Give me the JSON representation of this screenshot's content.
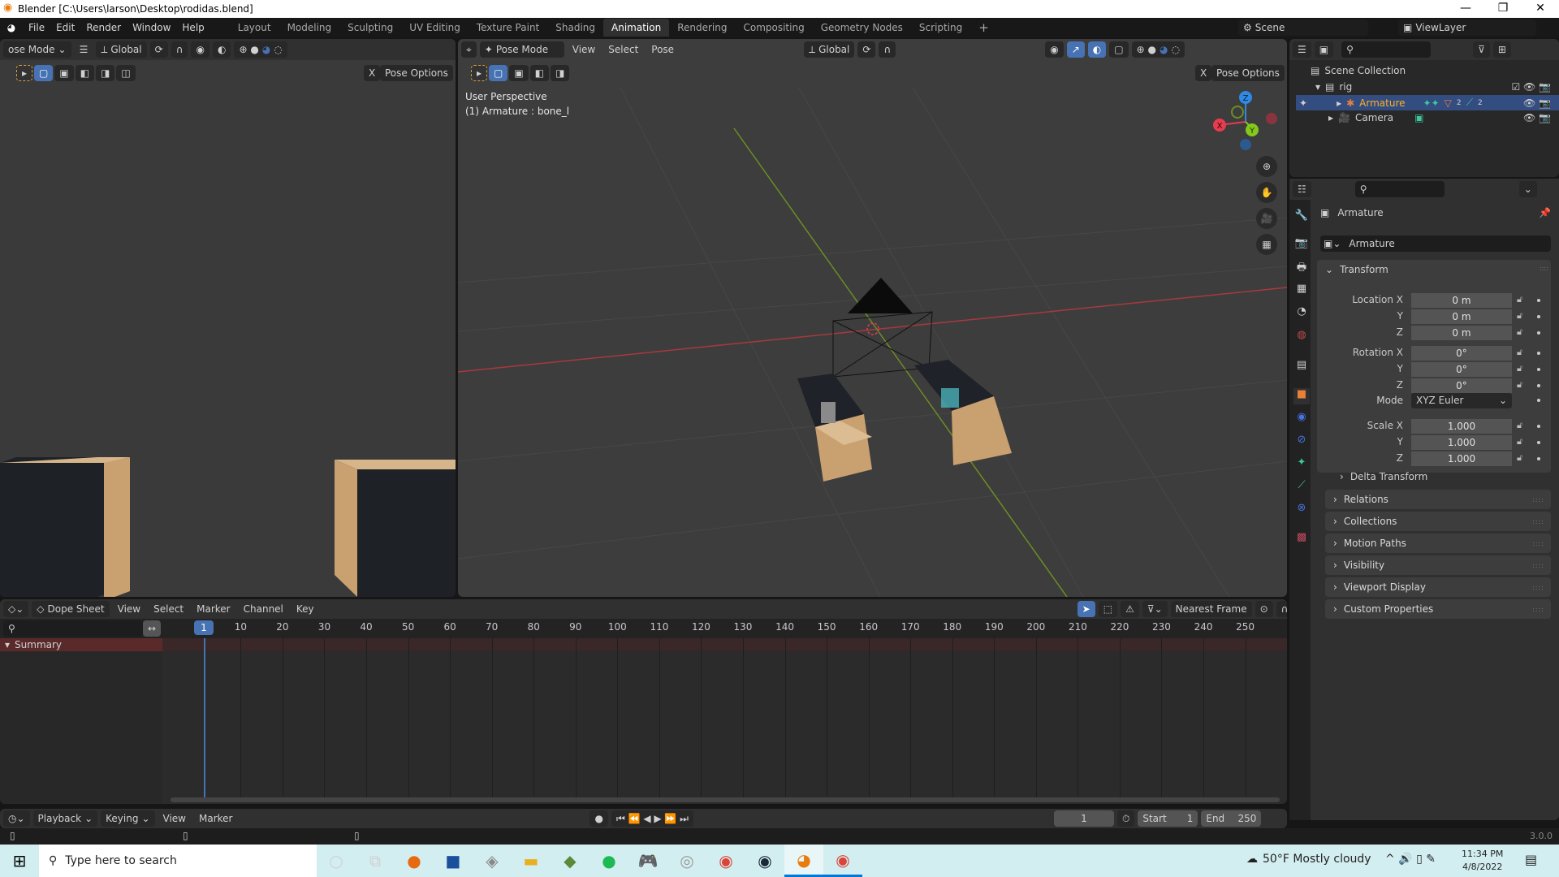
{
  "window": {
    "title": "Blender [C:\\Users\\larson\\Desktop\\rodidas.blend]",
    "minimize": "—",
    "maximize": "❐",
    "close": "✕"
  },
  "menu": [
    "File",
    "Edit",
    "Render",
    "Window",
    "Help"
  ],
  "workspaces": [
    {
      "label": "Layout"
    },
    {
      "label": "Modeling"
    },
    {
      "label": "Sculpting"
    },
    {
      "label": "UV Editing"
    },
    {
      "label": "Texture Paint"
    },
    {
      "label": "Shading"
    },
    {
      "label": "Animation",
      "active": true
    },
    {
      "label": "Rendering"
    },
    {
      "label": "Compositing"
    },
    {
      "label": "Geometry Nodes"
    },
    {
      "label": "Scripting"
    }
  ],
  "add_workspace": "+",
  "scene": {
    "label": "Scene",
    "view_layer": "ViewLayer"
  },
  "left_viewport": {
    "mode": "ose Mode",
    "orientation": "Global",
    "pose_options": "Pose Options",
    "x_mirror": "X"
  },
  "viewport": {
    "mode": "Pose Mode",
    "menus": [
      "View",
      "Select",
      "Pose"
    ],
    "orientation": "Global",
    "pose_options": "Pose Options",
    "x_mirror": "X",
    "overlay_line1": "User Perspective",
    "overlay_line2": "(1) Armature : bone_l",
    "gizmo": {
      "x": "X",
      "y": "Y",
      "z": "Z"
    }
  },
  "outliner": {
    "root": "Scene Collection",
    "items": [
      {
        "name": "rig",
        "level": 0
      },
      {
        "name": "Armature",
        "level": 1,
        "selected": true,
        "badges": [
          "2",
          "2"
        ]
      },
      {
        "name": "Camera",
        "level": 1
      }
    ]
  },
  "properties": {
    "object_name": "Armature",
    "data_name": "Armature",
    "transform": {
      "title": "Transform",
      "location": {
        "label": "Location X",
        "x": "0 m",
        "y": "0 m",
        "z": "0 m"
      },
      "rotation": {
        "label": "Rotation X",
        "x": "0°",
        "y": "0°",
        "z": "0°"
      },
      "mode_label": "Mode",
      "mode": "XYZ Euler",
      "scale": {
        "label": "Scale X",
        "x": "1.000",
        "y": "1.000",
        "z": "1.000"
      },
      "y_label": "Y",
      "z_label": "Z"
    },
    "delta": "Delta Transform",
    "sections": [
      "Relations",
      "Collections",
      "Motion Paths",
      "Visibility",
      "Viewport Display",
      "Custom Properties"
    ]
  },
  "dopesheet": {
    "mode": "Dope Sheet",
    "menus": [
      "View",
      "Select",
      "Marker",
      "Channel",
      "Key"
    ],
    "snap": "Nearest Frame",
    "current_frame": "1",
    "ticks": [
      "10",
      "20",
      "30",
      "40",
      "50",
      "60",
      "70",
      "80",
      "90",
      "100",
      "110",
      "120",
      "130",
      "140",
      "150",
      "160",
      "170",
      "180",
      "190",
      "200",
      "210",
      "220",
      "230",
      "240",
      "250"
    ],
    "summary": "Summary"
  },
  "timeline": {
    "menus": [
      "Playback",
      "Keying",
      "View",
      "Marker"
    ],
    "frame": "1",
    "start_label": "Start",
    "start": "1",
    "end_label": "End",
    "end": "250"
  },
  "status": {
    "version": "3.0.0"
  },
  "taskbar": {
    "search_placeholder": "Type here to search",
    "weather": "50°F  Mostly cloudy",
    "time": "11:34 PM",
    "date": "4/8/2022"
  },
  "colors": {
    "accent": "#4772b3",
    "selected_row": "#334d80",
    "armature_text": "#ffaf29",
    "x_axis": "#e63c50",
    "y_axis": "#84c81e",
    "z_axis": "#2e8ae6",
    "summary_row": "#4a2a2a"
  }
}
